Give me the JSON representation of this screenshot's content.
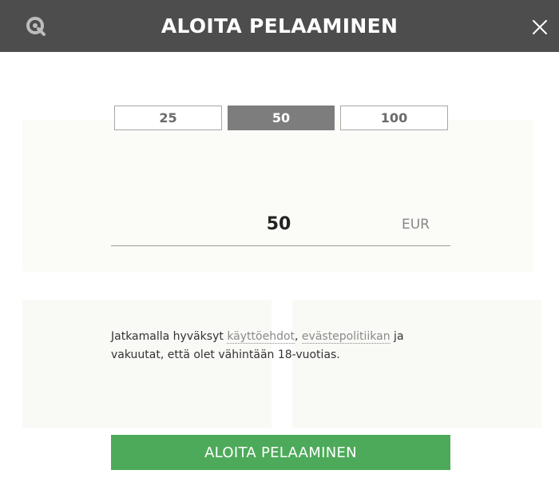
{
  "header": {
    "title": "ALOITA PELAAMINEN",
    "logo_icon": "q-logo-icon",
    "close_icon": "close-icon"
  },
  "presets": [
    {
      "label": "25",
      "active": false
    },
    {
      "label": "50",
      "active": true
    },
    {
      "label": "100",
      "active": false
    }
  ],
  "amount": {
    "value": "50",
    "currency": "EUR"
  },
  "terms": {
    "prefix": "Jatkamalla hyväksyt ",
    "terms_link": "käyttöehdot",
    "separator": ", ",
    "cookie_link": "evästepolitiikan",
    "suffix": " ja vakuutat, että olet vähintään 18-vuotias."
  },
  "cta": {
    "label": "ALOITA PELAAMINEN"
  },
  "colors": {
    "header_bg": "#4d4d4d",
    "preset_active_bg": "#7d7d7d",
    "cta_bg": "#4daa5a"
  }
}
